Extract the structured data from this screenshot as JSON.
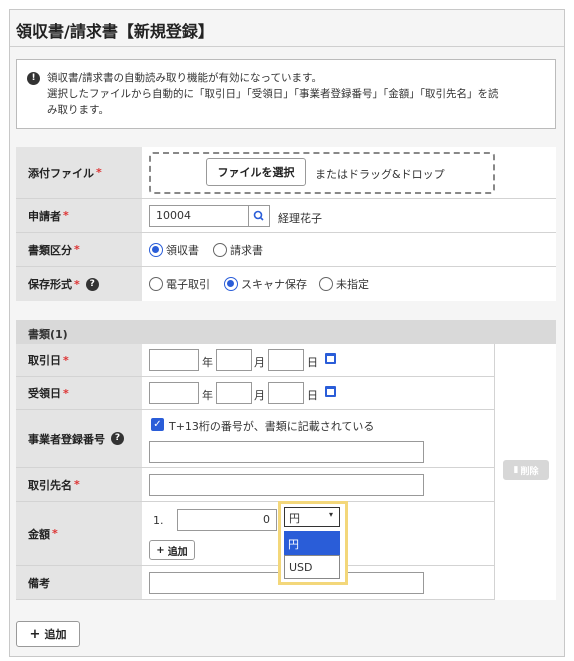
{
  "page": {
    "title": "領収書/請求書【新規登録】",
    "info_line1": "領収書/請求書の自動読み取り機能が有効になっています。",
    "info_line2": "選択したファイルから自動的に「取引日」「受領日」「事業者登録番号」「金額」「取引先名」を読",
    "info_line3": "み取ります。"
  },
  "labels": {
    "attachment": "添付ファイル",
    "applicant": "申請者",
    "doc_type": "書類区分",
    "save_format": "保存形式",
    "section": "書類(1)",
    "trade_date": "取引日",
    "receipt_date": "受領日",
    "reg_number": "事業者登録番号",
    "partner": "取引先名",
    "amount": "金額",
    "memo": "備考",
    "required": "*"
  },
  "file": {
    "button": "ファイルを選択",
    "hint": "またはドラッグ&ドロップ"
  },
  "applicant": {
    "id": "10004",
    "name": "経理花子"
  },
  "doc_type": {
    "opt1": "領収書",
    "opt2": "請求書"
  },
  "save_format": {
    "opt1": "電子取引",
    "opt2": "スキャナ保存",
    "opt3": "未指定"
  },
  "date_units": {
    "year": "年",
    "month": "月",
    "day": "日"
  },
  "reg_number": {
    "checkbox_label": "T+13桁の番号が、書類に記載されている"
  },
  "amount": {
    "index": "1.",
    "value": "0",
    "currency": "円",
    "options": [
      "円",
      "USD"
    ],
    "add": "追加"
  },
  "delete_button": "削除",
  "footer_add": "追加",
  "colors": {
    "accent": "#2a5dd8",
    "required": "#dd3333",
    "highlight": "#f3d77a"
  }
}
